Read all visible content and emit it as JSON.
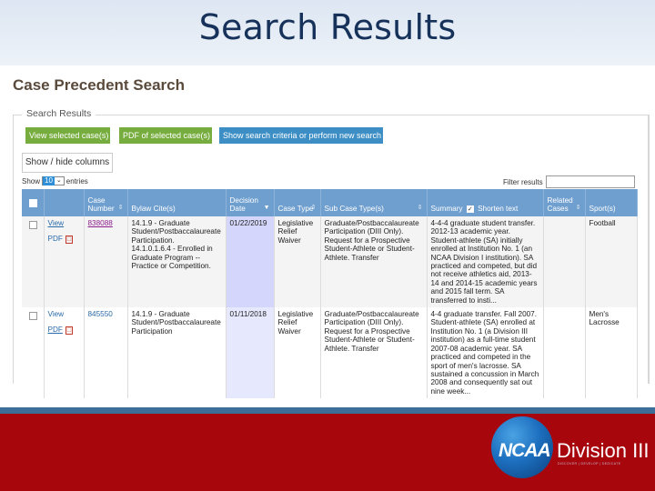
{
  "slide": {
    "title": "Search Results"
  },
  "app": {
    "title": "Case Precedent Search",
    "section_legend": "Search Results",
    "buttons": {
      "view_selected": "View selected case(s)",
      "pdf_selected": "PDF of selected case(s)",
      "show_criteria": "Show search criteria or perform new search",
      "show_hide_columns": "Show / hide columns"
    },
    "entries": {
      "prefix": "Show",
      "value": "10",
      "suffix": "entries"
    },
    "filter": {
      "label": "Filter results",
      "value": ""
    }
  },
  "table": {
    "headers": {
      "case_number": "Case Number",
      "bylaw": "Bylaw Cite(s)",
      "decision_date": "Decision Date",
      "case_type": "Case Type",
      "sub_case_type": "Sub Case Type(s)",
      "summary": "Summary",
      "shorten_text": "Shorten text",
      "related_cases": "Related Cases",
      "sports": "Sport(s)"
    },
    "sort_icons": {
      "unsorted": "⇕",
      "desc": "▼"
    },
    "rows": [
      {
        "view_label": "View",
        "pdf_label": "PDF",
        "case_number": "838088",
        "bylaw_cites": [
          "14.1.9 - Graduate Student/Postbaccalaureate Participation.",
          "14.1.0.1.6.4 - Enrolled in Graduate Program -- Practice or Competition."
        ],
        "decision_date": "01/22/2019",
        "case_type": "Legislative Relief Waiver",
        "sub_case_type": "Graduate/Postbaccalaureate Participation (DIII Only). Request for a Prospective Student-Athlete or Student-Athlete. Transfer",
        "summary": "4-4-4 graduate student transfer. 2012-13 academic year. Student-athlete (SA) initially enrolled at Institution No. 1 (an NCAA Division I institution). SA practiced and competed, but did not receive athletics aid, 2013-14 and 2014-15 academic years and 2015 fall term. SA transferred to insti...",
        "related_cases": "",
        "sports": "Football"
      },
      {
        "view_label": "View",
        "pdf_label": "PDF",
        "case_number": "845550",
        "bylaw_cites": [
          "14.1.9 - Graduate Student/Postbaccalaureate Participation"
        ],
        "decision_date": "01/11/2018",
        "case_type": "Legislative Relief Waiver",
        "sub_case_type": "Graduate/Postbaccalaureate Participation (DIII Only). Request for a Prospective Student-Athlete or Student-Athlete. Transfer",
        "summary": "4-4 graduate transfer. Fall 2007. Student-athlete (SA) enrolled at Institution No. 1 (a Division III institution) as a full-time student 2007-08 academic year. SA practiced and competed in the sport of men's lacrosse. SA sustained a concussion in March 2008 and consequently sat out nine week...",
        "related_cases": "",
        "sports": "Men's Lacrosse"
      }
    ]
  },
  "branding": {
    "ncaa": "NCAA",
    "division": "Division III",
    "tagline": "DISCOVER | DEVELOP | DEDICATE",
    "colors": {
      "footer_red": "#a6060c",
      "stripe_blue": "#3d6e98",
      "header_blue": "#6f9fcf",
      "button_green": "#76ad3e",
      "button_blue": "#3d8ec4"
    }
  }
}
